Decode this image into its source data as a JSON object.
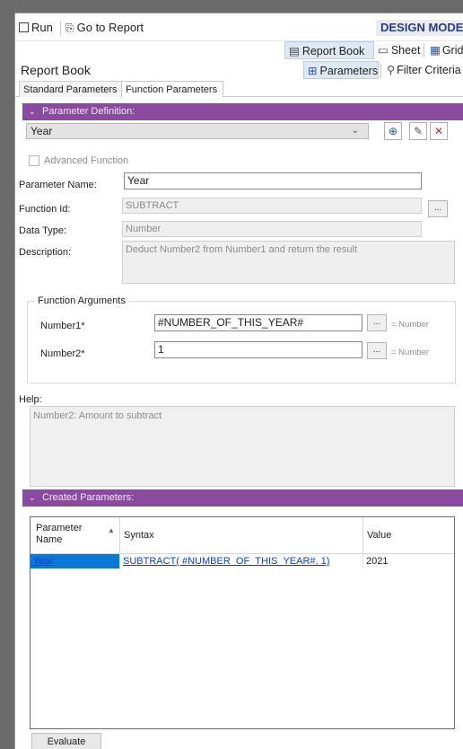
{
  "toolbar": {
    "run_label": "Run",
    "goto_label": "Go to Report",
    "mode_label": "DESIGN MODE"
  },
  "ribbon": {
    "report_book": "Report Book",
    "sheet": "Sheet",
    "grid": "Grid",
    "parameters": "Parameters",
    "filter_criteria": "Filter Criteria"
  },
  "page": {
    "title": "Report Book",
    "tabs": [
      {
        "label": "Standard Parameters",
        "active": false
      },
      {
        "label": "Function Parameters",
        "active": true
      }
    ]
  },
  "definition": {
    "header": "Parameter Definition:",
    "selected_parameter": "Year",
    "advanced_function_label": "Advanced Function",
    "parameter_name_label": "Parameter Name:",
    "parameter_name_value": "Year",
    "function_id_label": "Function Id:",
    "function_id_value": "SUBTRACT",
    "data_type_label": "Data Type:",
    "data_type_value": "Number",
    "description_label": "Description:",
    "description_value": "Deduct Number2 from Number1 and return the result"
  },
  "arguments": {
    "group_title": "Function Arguments",
    "items": [
      {
        "label": "Number1*",
        "value": "#NUMBER_OF_THIS_YEAR#",
        "result": "= Number"
      },
      {
        "label": "Number2*",
        "value": "1",
        "result": "= Number"
      }
    ],
    "ellipsis": "..."
  },
  "help": {
    "label": "Help:",
    "text": "Number2: Amount to subtract"
  },
  "created": {
    "header": "Created Parameters:",
    "columns": [
      "Parameter Name",
      "Syntax",
      "Value"
    ],
    "rows": [
      {
        "name": "Year",
        "syntax": "SUBTRACT( #NUMBER_OF_THIS_YEAR#, 1)",
        "value": "2021"
      }
    ]
  },
  "evaluate_label": "Evaluate",
  "colors": {
    "section_bar": "#8a4aa0",
    "link": "#0b3fd1",
    "selected_row": "#0a78d7",
    "design_mode_text": "#2a3a8c"
  },
  "icons": [
    "run-icon",
    "goto-report-icon",
    "report-book-icon",
    "sheet-icon",
    "grid-icon",
    "parameters-icon",
    "filter-icon",
    "chevron-down-icon",
    "sort-asc-icon"
  ]
}
